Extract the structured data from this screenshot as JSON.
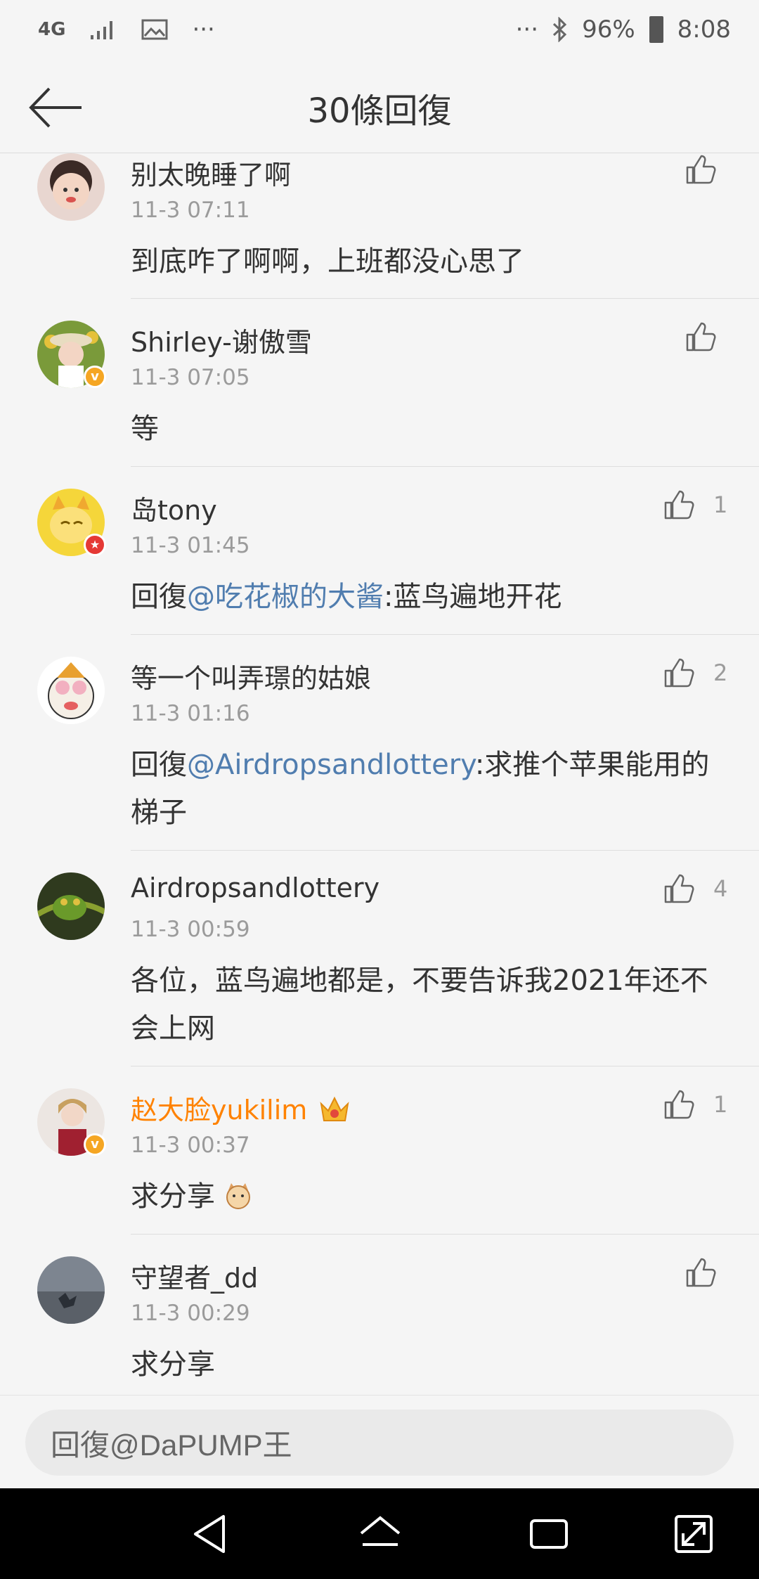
{
  "status": {
    "network": "4G",
    "dots_left": "···",
    "dots_right": "···",
    "battery": "96%",
    "time": "8:08"
  },
  "header": {
    "title": "30條回復"
  },
  "comments": [
    {
      "name": "别太晚睡了啊",
      "time": "11-3 07:11",
      "text": "到底咋了啊啊，上班都没心思了",
      "likes": ""
    },
    {
      "name": "Shirley-谢傲雪",
      "time": "11-3 07:05",
      "text": "等",
      "likes": ""
    },
    {
      "name": "岛tony",
      "time": "11-3 01:45",
      "prefix": "回復",
      "mention": "@吃花椒的大酱",
      "text": ":蓝鸟遍地开花",
      "likes": "1"
    },
    {
      "name": "等一个叫弄璟的姑娘",
      "time": "11-3 01:16",
      "prefix": "回復",
      "mention": "@Airdropsandlottery",
      "text": ":求推个苹果能用的梯子",
      "likes": "2"
    },
    {
      "name": "Airdropsandlottery",
      "time": "11-3 00:59",
      "text": "各位，蓝鸟遍地都是，不要告诉我2021年还不会上网",
      "likes": "4"
    },
    {
      "name": "赵大脸yukilim",
      "time": "11-3 00:37",
      "text": "求分享",
      "likes": "1"
    },
    {
      "name": "守望者_dd",
      "time": "11-3 00:29",
      "text": "求分享",
      "likes": ""
    }
  ],
  "reply": {
    "placeholder": "回復@DaPUMP王"
  },
  "colors": {
    "accent_link": "#507daf",
    "vip_name": "#ff8200",
    "verified_badge": "#f5a623"
  },
  "icons": [
    "back-arrow-icon",
    "like-icon",
    "nav-back-icon",
    "nav-home-icon",
    "nav-recents-icon",
    "nav-expand-icon"
  ]
}
